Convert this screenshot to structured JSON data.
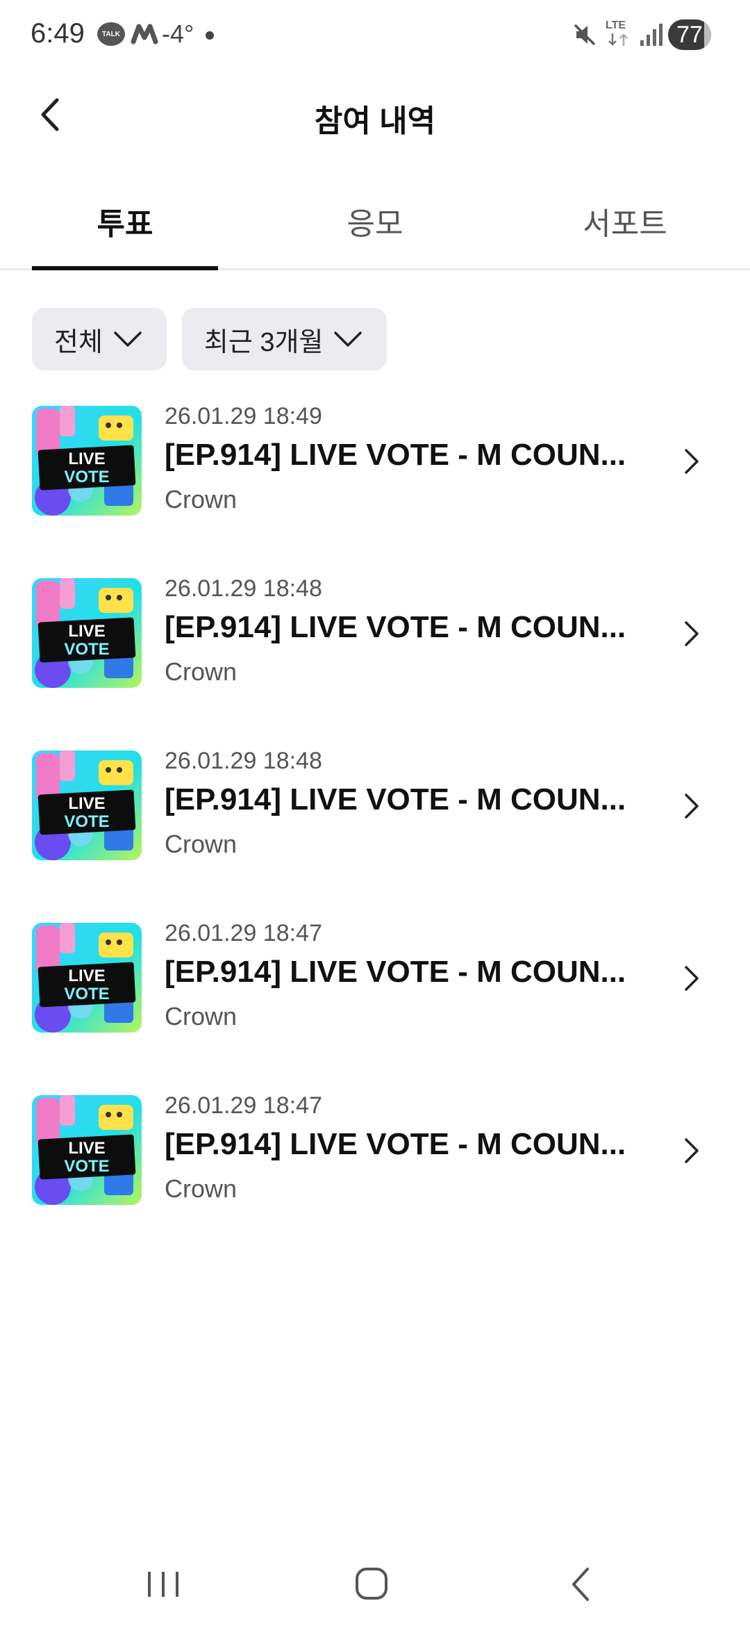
{
  "status_bar": {
    "time": "6:49",
    "talk_badge": "TALK",
    "temperature": "-4°",
    "network": "LTE",
    "battery": "77"
  },
  "header": {
    "title": "참여 내역"
  },
  "tabs": [
    {
      "label": "투표",
      "active": true
    },
    {
      "label": "응모",
      "active": false
    },
    {
      "label": "서포트",
      "active": false
    }
  ],
  "filters": {
    "category": "전체",
    "period": "최근 3개월"
  },
  "items": [
    {
      "date": "26.01.29 18:49",
      "title": "[EP.914] LIVE VOTE - M COUN...",
      "subtitle": "Crown"
    },
    {
      "date": "26.01.29 18:48",
      "title": "[EP.914] LIVE VOTE - M COUN...",
      "subtitle": "Crown"
    },
    {
      "date": "26.01.29 18:48",
      "title": "[EP.914] LIVE VOTE - M COUN...",
      "subtitle": "Crown"
    },
    {
      "date": "26.01.29 18:47",
      "title": "[EP.914] LIVE VOTE - M COUN...",
      "subtitle": "Crown"
    },
    {
      "date": "26.01.29 18:47",
      "title": "[EP.914] LIVE VOTE - M COUN...",
      "subtitle": "Crown"
    }
  ],
  "thumbnail": {
    "line1": "LIVE",
    "line2": "VOTE"
  }
}
